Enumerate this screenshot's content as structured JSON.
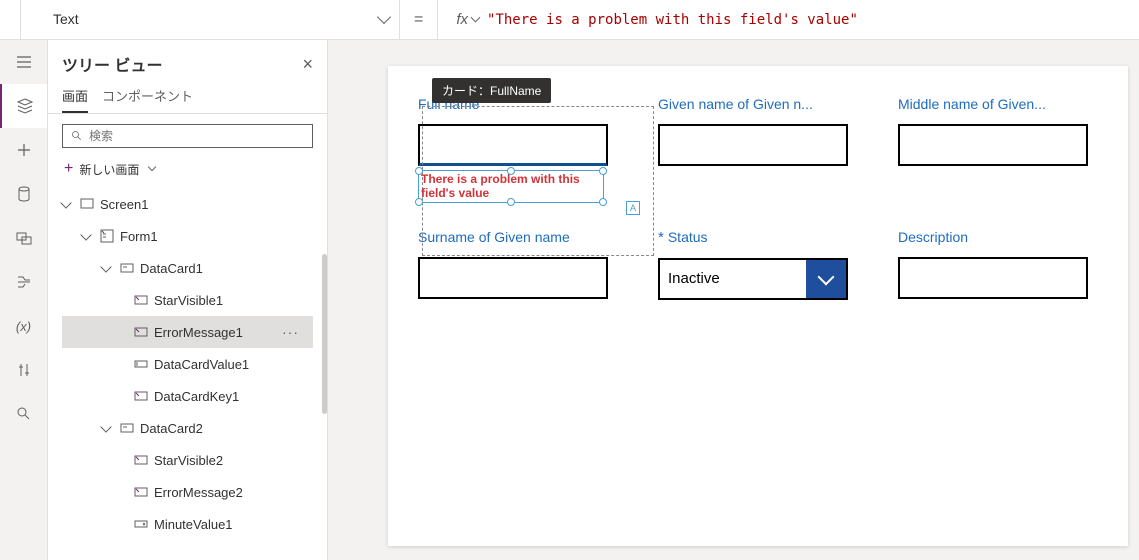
{
  "property_selector": "Text",
  "formula": "\"There is a problem with this field's value\"",
  "tree": {
    "title": "ツリー ビュー",
    "tabs": {
      "screens": "画面",
      "components": "コンポーネント"
    },
    "search_placeholder": "検索",
    "new_screen": "新しい画面",
    "nodes": {
      "screen": "Screen1",
      "form": "Form1",
      "card1": "DataCard1",
      "star1": "StarVisible1",
      "error1": "ErrorMessage1",
      "val1": "DataCardValue1",
      "key1": "DataCardKey1",
      "card2": "DataCard2",
      "star2": "StarVisible2",
      "error2": "ErrorMessage2",
      "minute1": "MinuteValue1"
    }
  },
  "canvas": {
    "tooltip": "カード：FullName",
    "fields": {
      "fullname": "Full name",
      "given": "Given name of Given n...",
      "middle": "Middle name of Given...",
      "surname": "Surname of Given name",
      "status": "Status",
      "status_value": "Inactive",
      "desc": "Description"
    },
    "error_text": "There is a problem with this field's value",
    "a_badge": "A"
  }
}
